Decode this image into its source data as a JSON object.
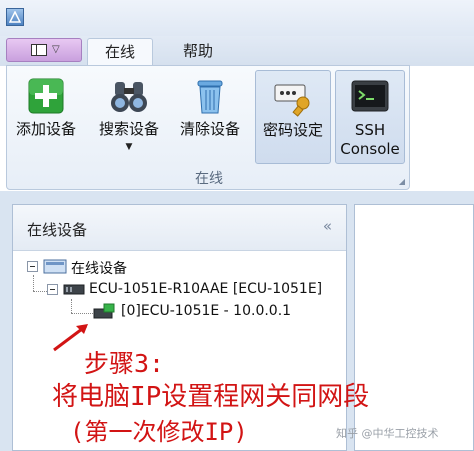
{
  "window": {
    "icon": "app-icon"
  },
  "tabs": [
    {
      "label": "在线",
      "active": true
    },
    {
      "label": "帮助",
      "active": false
    }
  ],
  "ribbon": {
    "buttons": [
      {
        "label": "添加设备",
        "icon": "plus-icon"
      },
      {
        "label": "搜索设备",
        "icon": "binoculars-icon",
        "dropdown": "▼"
      },
      {
        "label": "清除设备",
        "icon": "trash-icon"
      },
      {
        "label": "密码设定",
        "icon": "password-key-icon",
        "pressed": true
      },
      {
        "label": "SSH\nConsole",
        "icon": "terminal-icon",
        "pressed": true
      }
    ],
    "group_label": "在线"
  },
  "nav_panel": {
    "title": "在线设备",
    "collapse_glyph": "«",
    "tree": [
      {
        "text": "在线设备",
        "icon": "network-icon"
      },
      {
        "text": "ECU-1051E-R10AAE [ECU-1051E]",
        "icon": "device-icon"
      },
      {
        "text": "[0]ECU-1051E  - 10.0.0.1",
        "icon": "device-online-icon"
      }
    ]
  },
  "annotation": {
    "line1": "步骤3:",
    "line2": "将电脑IP设置程网关同网段",
    "line3": "(第一次修改IP)",
    "color": "#d21414"
  },
  "watermark": "知乎 @中华工控技术"
}
